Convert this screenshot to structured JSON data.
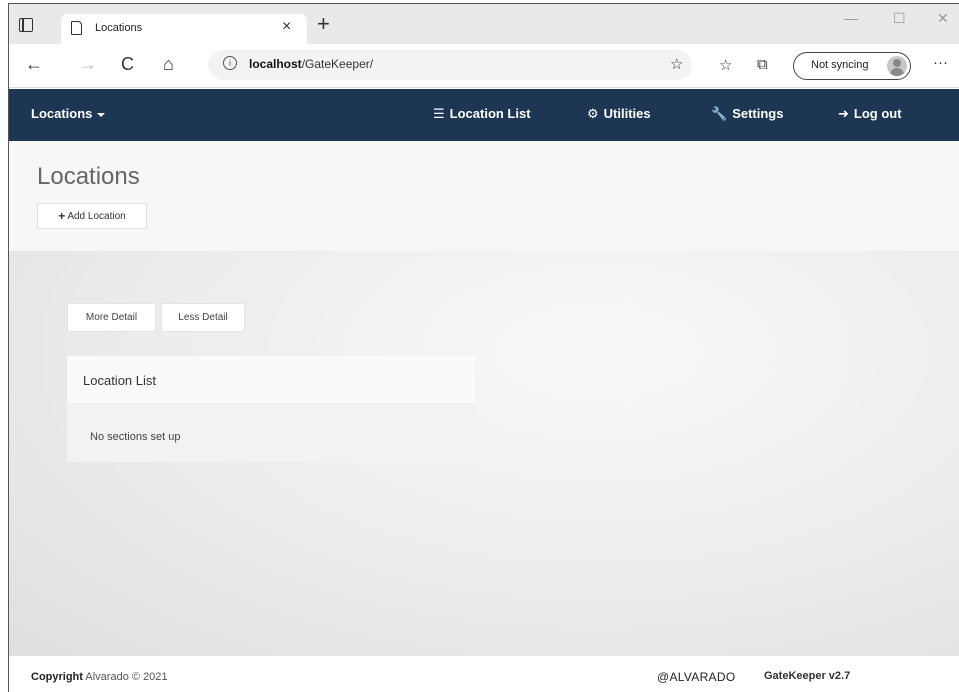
{
  "browser": {
    "tab_title": "Locations",
    "tab_close": "×",
    "new_tab": "+",
    "window_controls": {
      "minimize": "—",
      "maximize": "☐",
      "close": "✕"
    },
    "nav": {
      "back": "←",
      "forward": "→",
      "reload": "C",
      "home": "⌂"
    },
    "url_host": "localhost",
    "url_path": "/GateKeeper/",
    "sync_label": "Not syncing",
    "more": "···",
    "icons": [
      "tab-actions-icon",
      "page-icon",
      "info-icon",
      "add-favorite-icon",
      "favorites-icon",
      "collections-icon",
      "profile-avatar-icon"
    ]
  },
  "navbar": {
    "brand_menu": "Locations",
    "items": [
      {
        "label": "Location List",
        "icon": "☰"
      },
      {
        "label": "Utilities",
        "icon": "⚙"
      },
      {
        "label": "Settings",
        "icon": "🔧"
      },
      {
        "label": "Log out",
        "icon": "➜"
      }
    ],
    "background": "#1c3653"
  },
  "header": {
    "title": "Locations",
    "add_button": "Add Location",
    "add_icon": "+"
  },
  "content": {
    "more_detail": "More Detail",
    "less_detail": "Less Detail",
    "panel_title": "Location List",
    "empty_text": "No sections set up"
  },
  "footer": {
    "copyright_label": "Copyright",
    "copyright_text": "Alvarado © 2021",
    "brand": "ALVARADO",
    "brand_mark": "@",
    "product": "GateKeeper v2.7"
  }
}
